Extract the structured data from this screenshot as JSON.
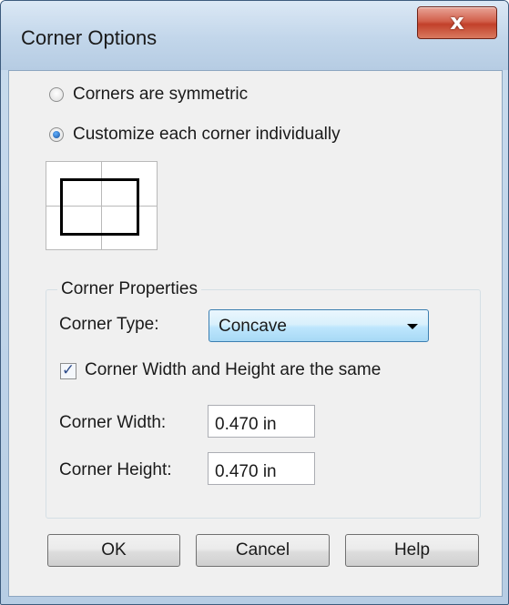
{
  "window": {
    "title": "Corner Options",
    "close_glyph": "x"
  },
  "corner_mode": {
    "options": [
      {
        "label": "Corners are symmetric",
        "checked": false
      },
      {
        "label": "Customize each corner individually",
        "checked": true
      }
    ]
  },
  "corner_properties": {
    "group_label": "Corner Properties",
    "type_label": "Corner Type:",
    "type_value": "Concave",
    "same_size_label": "Corner Width and Height are the same",
    "same_size_checked": true,
    "same_size_glyph": "✓",
    "width_label": "Corner Width:",
    "width_value": "0.470 in",
    "height_label": "Corner Height:",
    "height_value": "0.470 in"
  },
  "buttons": {
    "ok": "OK",
    "cancel": "Cancel",
    "help": "Help"
  }
}
